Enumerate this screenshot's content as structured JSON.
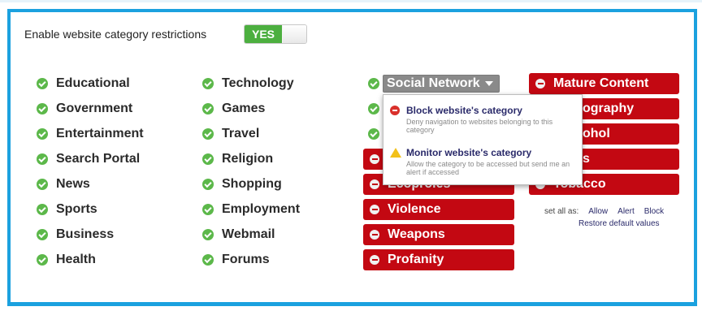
{
  "toggle": {
    "label": "Enable website category restrictions",
    "value": "YES"
  },
  "allowed_col1": [
    "Educational",
    "Government",
    "Entertainment",
    "Search Portal",
    "News",
    "Sports",
    "Business",
    "Health"
  ],
  "allowed_col2": [
    "Technology",
    "Games",
    "Travel",
    "Religion",
    "Shopping",
    "Employment",
    "Webmail",
    "Forums"
  ],
  "dropdown": {
    "label": "Social Network"
  },
  "blocked_col3": [
    "Violence",
    "Weapons",
    "Profanity"
  ],
  "blocked_col3_partial": {
    "row4": "",
    "row5": "Ecoproles"
  },
  "blocked_col4": {
    "r1": "Mature Content",
    "r2": "ography",
    "r3": "ohol",
    "r4": "s",
    "r5": "Tobacco"
  },
  "popup": {
    "block": {
      "title": "Block website's category",
      "desc": "Deny navigation to websites belonging to this category"
    },
    "monitor": {
      "title": "Monitor website's category",
      "desc": "Allow the category to be accessed but send me an alert if accessed"
    }
  },
  "setall": {
    "label": "set all as:",
    "allow": "Allow",
    "alert": "Alert",
    "block": "Block",
    "restore": "Restore default values"
  },
  "colors": {
    "accent": "#1ba1df",
    "allow": "#5cb84a",
    "block": "#c30812",
    "toggle": "#4caf3f"
  }
}
